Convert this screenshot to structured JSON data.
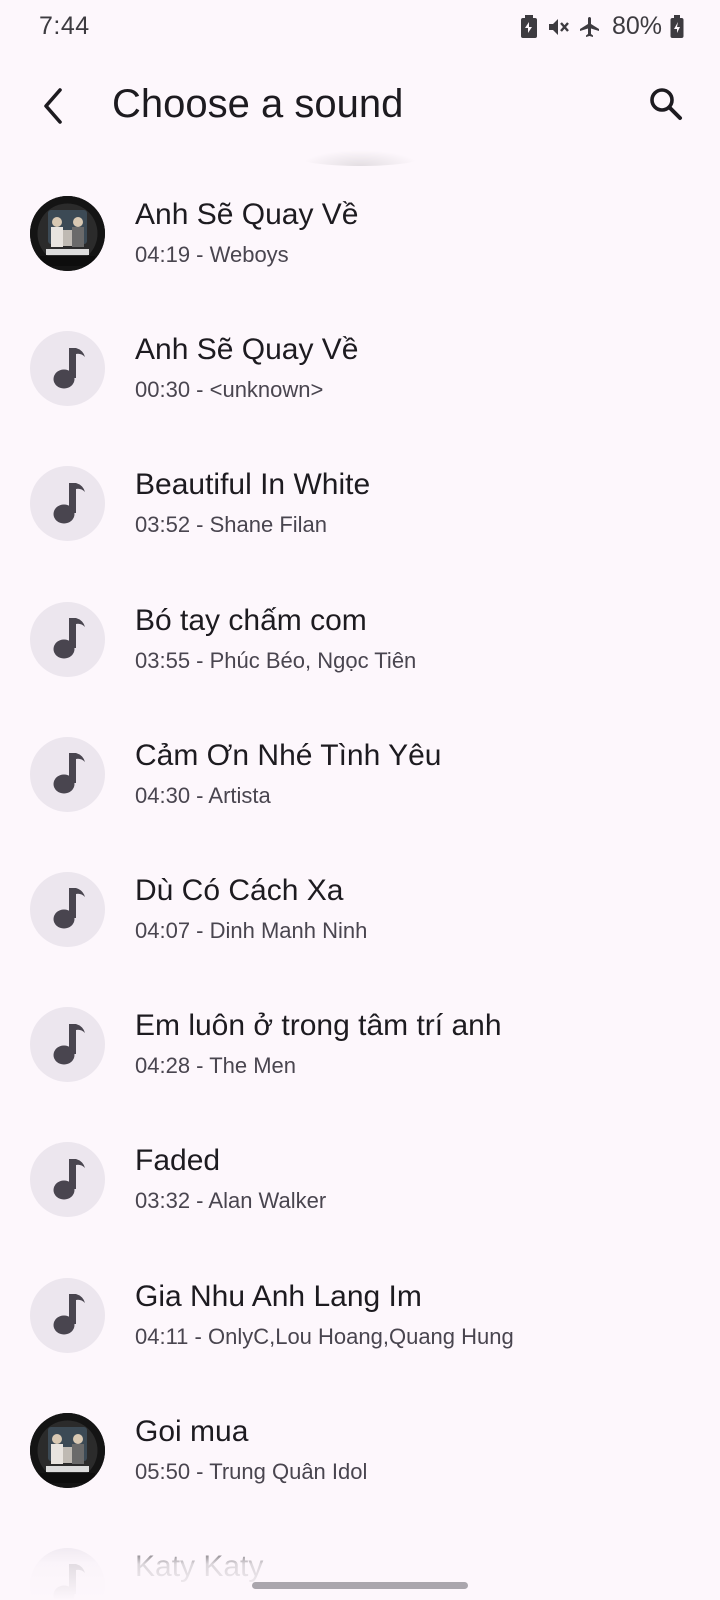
{
  "status_bar": {
    "time": "7:44",
    "battery_percent": "80%",
    "icons": [
      "battery-saver-icon",
      "vibrate-off-icon",
      "airplane-mode-icon",
      "battery-icon"
    ]
  },
  "app_bar": {
    "title": "Choose a sound",
    "back_icon": "back-arrow-icon",
    "search_icon": "search-icon"
  },
  "sounds": [
    {
      "title": "Anh Sẽ Quay Về",
      "subtitle": "04:19 - Weboys",
      "artwork": "album-art"
    },
    {
      "title": "Anh Sẽ Quay Về",
      "subtitle": "00:30 - <unknown>",
      "artwork": "music-note-icon"
    },
    {
      "title": "Beautiful In White",
      "subtitle": "03:52 - Shane Filan",
      "artwork": "music-note-icon"
    },
    {
      "title": "Bó tay chấm com",
      "subtitle": "03:55 - Phúc Béo, Ngọc Tiên",
      "artwork": "music-note-icon"
    },
    {
      "title": "Cảm Ơn Nhé Tình Yêu",
      "subtitle": "04:30 - Artista",
      "artwork": "music-note-icon"
    },
    {
      "title": "Dù Có Cách Xa",
      "subtitle": "04:07 - Dinh Manh Ninh",
      "artwork": "music-note-icon"
    },
    {
      "title": "Em luôn ở trong tâm trí anh",
      "subtitle": "04:28 - The Men",
      "artwork": "music-note-icon"
    },
    {
      "title": "Faded",
      "subtitle": "03:32 - Alan Walker",
      "artwork": "music-note-icon"
    },
    {
      "title": "Gia Nhu Anh Lang Im",
      "subtitle": "04:11 - OnlyC,Lou Hoang,Quang Hung",
      "artwork": "music-note-icon"
    },
    {
      "title": "Goi mua",
      "subtitle": "05:50 - Trung Quân Idol",
      "artwork": "album-art"
    },
    {
      "title": "Katy Katy",
      "subtitle": "",
      "artwork": "music-note-icon"
    }
  ],
  "colors": {
    "background": "#fdf7fc",
    "avatar_bg": "#ece6ee",
    "note_icon": "#49454f",
    "title_text": "#1d1b20",
    "subtitle_text": "#49454f"
  }
}
